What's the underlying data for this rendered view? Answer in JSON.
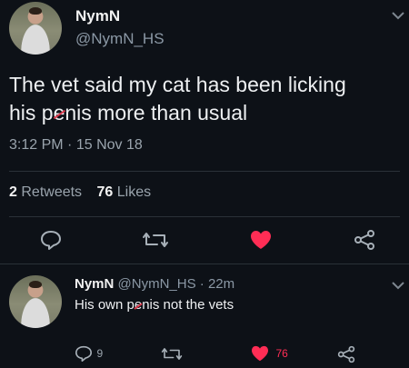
{
  "tweet": {
    "author_name": "NymN",
    "author_handle": "@NymN_HS",
    "text_line1": "The vet said my cat has been licking",
    "text_line2_pre": "his p",
    "text_line2_censored": "e",
    "text_line2_post": "nis more than usual",
    "time": "3:12 PM",
    "separator": "·",
    "date": "15 Nov 18",
    "retweets_count": "2",
    "retweets_label": "Retweets",
    "likes_count": "76",
    "likes_label": "Likes",
    "icons": [
      "reply-icon",
      "retweet-icon",
      "like-heart-icon",
      "share-icon",
      "chevron-down-icon"
    ],
    "like_color": "#ff2d55"
  },
  "reply": {
    "author_name": "NymN",
    "author_handle": "@NymN_HS",
    "separator": "·",
    "age": "22m",
    "text_pre": "His own p",
    "text_censored": "e",
    "text_post": "nis not the vets",
    "reply_count": "9",
    "like_count": "76",
    "icons": [
      "reply-icon",
      "retweet-icon",
      "like-heart-icon",
      "share-icon",
      "chevron-down-icon"
    ],
    "like_color": "#ff2d55"
  }
}
